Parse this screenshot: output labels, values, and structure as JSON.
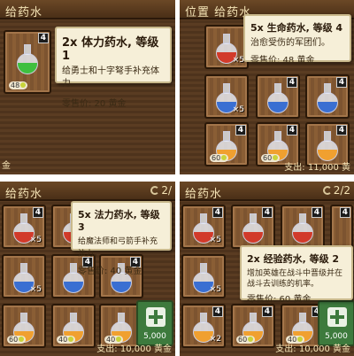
{
  "panels": [
    {
      "title": "给药水",
      "exit_hint": "金",
      "tip": {
        "name": "2x 体力药水, 等级 1",
        "desc": "给勇士和十字弩手补充体力。",
        "sale": "零售价: 20 黄金"
      },
      "featured_slot": {
        "level": "4",
        "price": "48",
        "color": "#3fbf3f"
      }
    },
    {
      "title": "位置 给药水",
      "tip": {
        "name": "5x 生命药水, 等级 4",
        "desc": "治愈受伤的军团们。",
        "sale": "零售价: 48 黄金"
      },
      "footer": "支出: 11,000 黄"
    },
    {
      "title": "给药水",
      "counter": "2/",
      "tip": {
        "name": "5x 法力药水, 等级 3",
        "desc": "给魔法师和弓箭手补充法力。",
        "sale": "零售价: 40 黄金"
      },
      "add_button_price": "5,000",
      "footer": "支出: 10,000 黄金"
    },
    {
      "title": "给药水",
      "counter": "2/2",
      "tip": {
        "name": "2x 经验药水, 等级 2",
        "desc": "增加英雄在战斗中晋级并在战斗去训练的机率。",
        "sale": "零售价: 60 黄金"
      },
      "add_button_price": "5,000",
      "footer": "支出: 10,000 黄金"
    }
  ],
  "slots": {
    "red": {
      "color": "#d23a2a",
      "qty": "×5",
      "level": "4"
    },
    "blue": {
      "color": "#3a6fd2",
      "qty": "×5",
      "level": "4"
    },
    "orange": {
      "color": "#f0a030",
      "qty": "×2",
      "level": "4"
    },
    "prices": [
      "60",
      "40",
      "48"
    ]
  }
}
